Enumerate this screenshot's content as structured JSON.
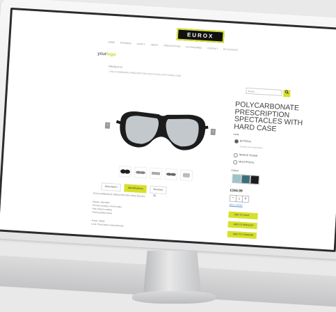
{
  "site": {
    "brand": "EUROX",
    "logo_text": [
      "your",
      "logo"
    ],
    "nav": [
      "HOME",
      "EYEWEAR",
      "SAFETY",
      "ABOUT",
      "PRESCRIPTION",
      "ACCESSORIES",
      "CONTACT",
      "MY ACCOUNT"
    ],
    "nav_active": 0
  },
  "breadcrumb": {
    "section": "PRODUCTS",
    "path": "› POLYCARBONATE PRESCRIPTION SPECTACLES WITH HARD CASE"
  },
  "gallery": {
    "prev": "‹",
    "next": "›",
    "thumbnail_count": 5
  },
  "tabs": [
    {
      "label": "Description",
      "active": false
    },
    {
      "label": "Specifications",
      "active": true
    },
    {
      "label": "Reviews (0)",
      "active": false
    }
  ],
  "description": {
    "heading": "POLYCARBONATE PRESCRIPTION SPECTACLES",
    "lines": [
      "Range: Standard",
      "Anti-fog coating on both sides",
      "Anti-scratch coating",
      "Foam padded frame",
      "",
      "Frame: Matte",
      "Lens: Prescription polycarbonate"
    ]
  },
  "search": {
    "placeholder": "Search",
    "button_icon": "search-icon"
  },
  "product": {
    "title": "POLYCARBONATE PRESCRIPTION SPECTACLES WITH HARD CASE",
    "lens_label": "Lens",
    "lens_options": [
      "BI-FOCAL",
      "SINGLE VISION",
      "MULTIFOCAL"
    ],
    "lens_selected": 0,
    "lens_note": "Choose your prescription",
    "colour_label": "Colour",
    "colours": [
      "#9cc4c8",
      "#3b6f7a",
      "#1b1b1b"
    ],
    "price": "£164.99",
    "quantity": "1",
    "qty_minus": "−",
    "qty_plus": "+",
    "stock_note": "Add to wishlist",
    "buttons": [
      "ADD TO CART",
      "ADD TO WISHLIST",
      "ADD TO COMPARE"
    ]
  },
  "colors": {
    "accent": "#d6e02a",
    "bezel": "#efefef",
    "screen_frame": "#2b2c2e"
  }
}
